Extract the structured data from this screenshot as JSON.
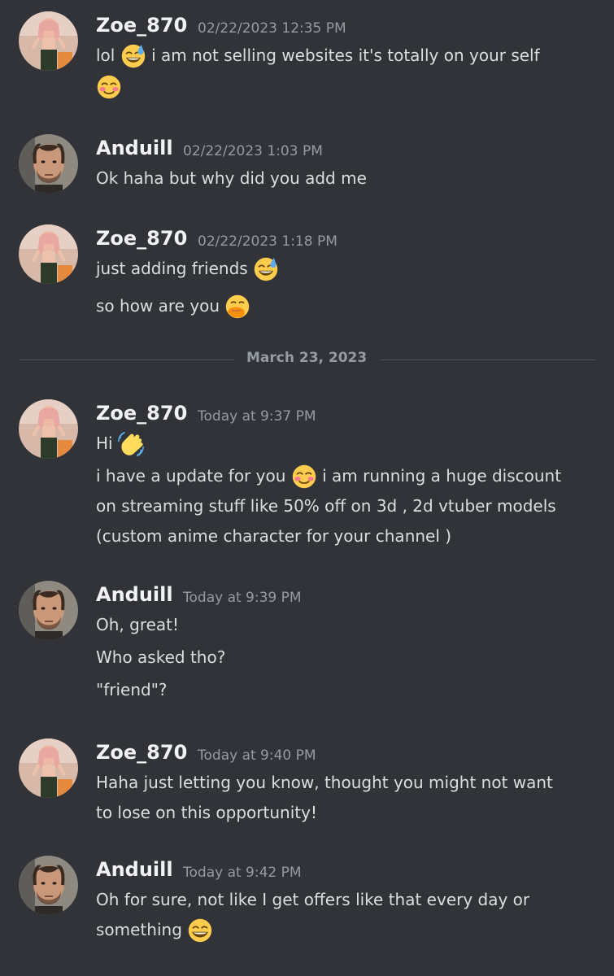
{
  "messages": [
    {
      "author": "Zoe_870",
      "timestamp": "02/22/2023 12:35 PM",
      "avatar": "avatar-zoe",
      "lines": [
        {
          "parts": [
            {
              "text": "lol "
            },
            {
              "emoji": "sweat-smile"
            },
            {
              "text": " i am not selling websites it's totally on your self"
            }
          ]
        },
        {
          "parts": [
            {
              "emoji": "blush"
            }
          ]
        }
      ]
    },
    {
      "author": "Anduill",
      "timestamp": "02/22/2023 1:03 PM",
      "avatar": "avatar-anduill",
      "lines": [
        {
          "parts": [
            {
              "text": "Ok haha but why did you add me"
            }
          ]
        }
      ]
    },
    {
      "author": "Zoe_870",
      "timestamp": "02/22/2023 1:18 PM",
      "avatar": "avatar-zoe",
      "lines": [
        {
          "parts": [
            {
              "text": "just adding friends "
            },
            {
              "emoji": "sweat-smile"
            }
          ]
        },
        {
          "parts": [
            {
              "text": "so how are you "
            },
            {
              "emoji": "hand-over-mouth"
            }
          ]
        }
      ]
    },
    {
      "author": "Zoe_870",
      "timestamp": "Today at 9:37 PM",
      "avatar": "avatar-zoe",
      "lines": [
        {
          "parts": [
            {
              "text": "Hi "
            },
            {
              "emoji": "wave"
            }
          ]
        },
        {
          "parts": [
            {
              "text": "i have a update for you "
            },
            {
              "emoji": "blush"
            },
            {
              "text": " i am running a huge discount"
            }
          ]
        },
        {
          "parts": [
            {
              "text": "on streaming stuff like 50% off on 3d , 2d vtuber models"
            }
          ]
        },
        {
          "parts": [
            {
              "text": "(custom anime character for your channel )"
            }
          ]
        }
      ]
    },
    {
      "author": "Anduill",
      "timestamp": "Today at 9:39 PM",
      "avatar": "avatar-anduill",
      "lines": [
        {
          "parts": [
            {
              "text": "Oh, great!"
            }
          ]
        },
        {
          "parts": [
            {
              "text": "Who asked tho?"
            }
          ]
        },
        {
          "parts": [
            {
              "text": "\"friend\"?"
            }
          ]
        }
      ]
    },
    {
      "author": "Zoe_870",
      "timestamp": "Today at 9:40 PM",
      "avatar": "avatar-zoe",
      "lines": [
        {
          "parts": [
            {
              "text": "Haha just letting you know, thought you might not want"
            }
          ]
        },
        {
          "parts": [
            {
              "text": "to lose on this opportunity!"
            }
          ]
        }
      ]
    },
    {
      "author": "Anduill",
      "timestamp": "Today at 9:42 PM",
      "avatar": "avatar-anduill",
      "lines": [
        {
          "parts": [
            {
              "text": "Oh for sure, not like I get offers like that every day or"
            }
          ]
        },
        {
          "parts": [
            {
              "text": "something "
            },
            {
              "emoji": "grin"
            }
          ]
        }
      ]
    }
  ],
  "divider": {
    "label": "March 23, 2023"
  },
  "colors": {
    "background": "#313338",
    "author": "#f2f3f5",
    "timestamp": "#949ba4",
    "text": "#dbdee1",
    "divider": "#4e5058"
  }
}
